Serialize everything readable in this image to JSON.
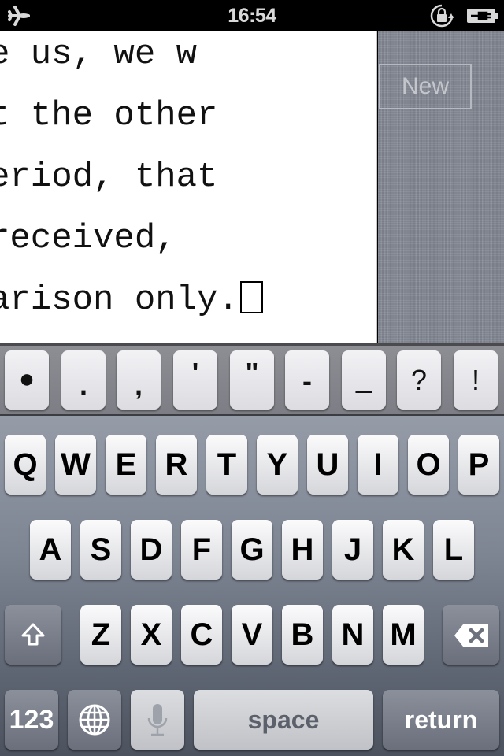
{
  "status_bar": {
    "time": "16:54",
    "icons": [
      "airplane-mode-icon",
      "rotation-lock-icon",
      "battery-charging-icon"
    ]
  },
  "editor": {
    "lines": [
      "e us, we w",
      "t the other",
      "eriod, that",
      "received,",
      "arison only."
    ]
  },
  "sidebar": {
    "new_button_label": "New"
  },
  "accessory_bar": {
    "keys": [
      "●",
      ".",
      ",",
      "'",
      "\"",
      "-",
      "_",
      "?",
      "!"
    ]
  },
  "keyboard": {
    "row1": [
      "Q",
      "W",
      "E",
      "R",
      "T",
      "Y",
      "U",
      "I",
      "O",
      "P"
    ],
    "row2": [
      "A",
      "S",
      "D",
      "F",
      "G",
      "H",
      "J",
      "K",
      "L"
    ],
    "row3": [
      "Z",
      "X",
      "C",
      "V",
      "B",
      "N",
      "M"
    ],
    "numbers_label": "123",
    "space_label": "space",
    "return_label": "return",
    "shift_icon": "shift-arrow-icon",
    "delete_icon": "backspace-icon",
    "globe_icon": "globe-icon",
    "mic_icon": "microphone-icon"
  }
}
